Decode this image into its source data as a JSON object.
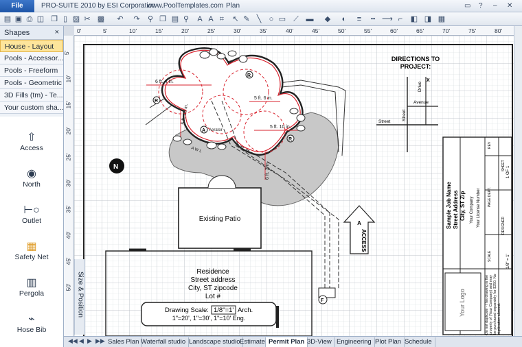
{
  "app": {
    "file_label": "File",
    "title": "PRO-SUITE 2010 by ESI Corporation",
    "website": "www.PoolTemplates.com",
    "document": "Plan"
  },
  "shapes_panel": {
    "header": "Shapes",
    "close": "×",
    "categories": [
      "House - Layout",
      "Pools - Accessor...",
      "Pools - Freeform",
      "Pools - Geometric",
      "3D Fills (tm) - Te...",
      "Your custom sha..."
    ],
    "stencils": [
      {
        "label": "Access",
        "icon": "arrow-up-icon",
        "glyph": "⇧"
      },
      {
        "label": "North",
        "icon": "north-arrow-icon",
        "glyph": "◉"
      },
      {
        "label": "Outlet",
        "icon": "outlet-icon",
        "glyph": "⊢○"
      },
      {
        "label": "Safety Net",
        "icon": "safety-net-icon",
        "glyph": "▦"
      },
      {
        "label": "Pergola",
        "icon": "pergola-icon",
        "glyph": "▥"
      },
      {
        "label": "Hose Bib",
        "icon": "hose-bib-icon",
        "glyph": "⌁"
      }
    ]
  },
  "size_position_label": "Size & Position",
  "ruler": {
    "h_ticks": [
      "0'",
      "5'",
      "10'",
      "15'",
      "20'",
      "25'",
      "30'",
      "35'",
      "40'",
      "45'",
      "50'",
      "55'",
      "60'",
      "65'",
      "70'",
      "75'",
      "80'"
    ],
    "v_ticks": [
      "5'",
      "10'",
      "15'",
      "20'",
      "25'",
      "30'",
      "35'",
      "40'",
      "45'",
      "50'"
    ]
  },
  "plan": {
    "directions_title": "DIRECTIONS TO",
    "directions_title2": "PROJECT:",
    "streets": {
      "drive": "Drive",
      "avenue": "Avenue",
      "street1": "Street",
      "street2": "Street",
      "x": "X"
    },
    "pool_dims": {
      "d1": "6 ft. 4 in.",
      "d2": "5 ft. 6 in.",
      "d3": "5 ft. 10 in.",
      "d4": "5 ft. 10 in.",
      "d5": "6 ft. 3 in."
    },
    "markers": {
      "r": "R",
      "a": "A",
      "aerator": "Aerator",
      "awl": "A W L",
      "f": "F"
    },
    "existing_patio": "Existing Patio",
    "access": "ACCESS",
    "residence": [
      "Residence",
      "Street address",
      "City, ST zipcode",
      "Lot #"
    ],
    "drawing_scale": {
      "label": "Drawing Scale:",
      "value": "1/8\"=1'",
      "suffix": "Arch.",
      "line2": "1\"=20', 1\"=30', 1\"=10' Eng."
    },
    "title_block": {
      "job": "Sample Job Name",
      "address": "Street Address",
      "city": "City, ST Zip",
      "company": "Your Company",
      "license": "Your License Number",
      "logo": "Your Logo",
      "disclaimer": "Do not duplicate - This drawing is the property of (Your Company) and may be purchased separately for $250. No duplication allowed.",
      "rev": "REV",
      "sheet": "SHEET",
      "sheet_value": "1 OF 1",
      "page_dept": "PAGE DEPT.",
      "designer": "DESIGNER",
      "scale": "SCALE",
      "scale_value": "1/8\" = 1'"
    }
  },
  "tabs": [
    "Sales Plan",
    "Waterfall studio",
    "Landscape studio",
    "Estimate",
    "Permit Plan",
    "3D-View",
    "Engineering",
    "Plot Plan",
    "Schedule"
  ],
  "active_tab": "Permit Plan",
  "colors": {
    "accent": "#1f56a8",
    "pool_red": "#d9232e",
    "patio_gray": "#c8c8c8"
  }
}
